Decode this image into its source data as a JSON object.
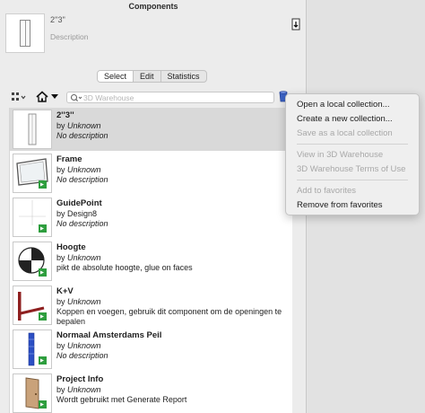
{
  "window": {
    "title": "Components"
  },
  "preview": {
    "name": "2''3''",
    "description": "Description"
  },
  "tabs": [
    {
      "label": "Select",
      "active": true
    },
    {
      "label": "Edit",
      "active": false
    },
    {
      "label": "Statistics",
      "active": false
    }
  ],
  "search": {
    "placeholder": "3D Warehouse",
    "value": ""
  },
  "components": [
    {
      "name": "2''3''",
      "by": "by ",
      "author": "Unknown",
      "description": "No description",
      "description_italic": true,
      "selected": true,
      "icon": "door-icon"
    },
    {
      "name": "Frame",
      "by": "by ",
      "author": "Unknown",
      "description": "No description",
      "description_italic": true,
      "selected": false,
      "icon": "frame-icon"
    },
    {
      "name": "GuidePoint",
      "by": "by ",
      "author": "Design8",
      "description": "No description",
      "description_italic": true,
      "selected": false,
      "icon": "guidepoint-icon"
    },
    {
      "name": "Hoogte",
      "by": "by ",
      "author": "Unknown",
      "description": "pikt de absolute hoogte, glue on faces",
      "description_italic": false,
      "selected": false,
      "icon": "height-marker-icon"
    },
    {
      "name": "K+V",
      "by": "by ",
      "author": "Unknown",
      "description": "Koppen en voegen, gebruik dit component om de openingen te bepalen",
      "description_italic": false,
      "selected": false,
      "icon": "joint-icon"
    },
    {
      "name": "Normaal Amsterdams Peil",
      "by": "by ",
      "author": "Unknown",
      "description": "No description",
      "description_italic": true,
      "selected": false,
      "icon": "nap-pole-icon"
    },
    {
      "name": "Project Info",
      "by": "by ",
      "author": "Unknown",
      "description": "Wordt gebruikt met Generate Report",
      "description_italic": false,
      "selected": false,
      "icon": "door-info-icon"
    }
  ],
  "menu": {
    "items": [
      {
        "label": "Open a local collection...",
        "enabled": true
      },
      {
        "label": "Create a new collection...",
        "enabled": true
      },
      {
        "label": "Save as a local collection",
        "enabled": false
      },
      {
        "separator": true
      },
      {
        "label": "View in 3D Warehouse",
        "enabled": false
      },
      {
        "label": "3D Warehouse Terms of Use",
        "enabled": false
      },
      {
        "separator": true
      },
      {
        "label": "Add to favorites",
        "enabled": false
      },
      {
        "label": "Remove from favorites",
        "enabled": true
      }
    ]
  },
  "colors": {
    "selection": "#d9d9d9",
    "menu_bg": "#efefef",
    "disabled_text": "#a8a8a8",
    "badge_green": "#2e9e3e"
  }
}
